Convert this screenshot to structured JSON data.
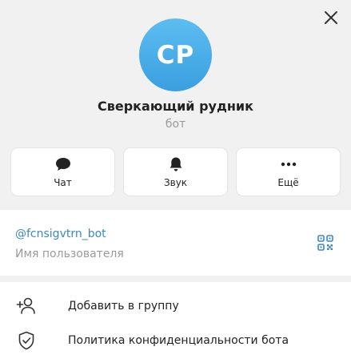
{
  "profile": {
    "avatar_initials": "СР",
    "name": "Сверкающий рудник",
    "subtitle": "бот",
    "avatar_color": "#45aae8"
  },
  "actions": [
    {
      "label": "Чат",
      "icon": "chat-bubble-icon"
    },
    {
      "label": "Звук",
      "icon": "bell-icon"
    },
    {
      "label": "Ещё",
      "icon": "more-dots-icon"
    }
  ],
  "info": {
    "username": "@fcnsigvtrn_bot",
    "username_caption": "Имя пользователя",
    "link_color": "#3a88c7"
  },
  "menu": [
    {
      "label": "Добавить в группу",
      "icon": "add-user-icon"
    },
    {
      "label": "Политика конфиденциальности бота",
      "icon": "shield-check-icon"
    }
  ]
}
